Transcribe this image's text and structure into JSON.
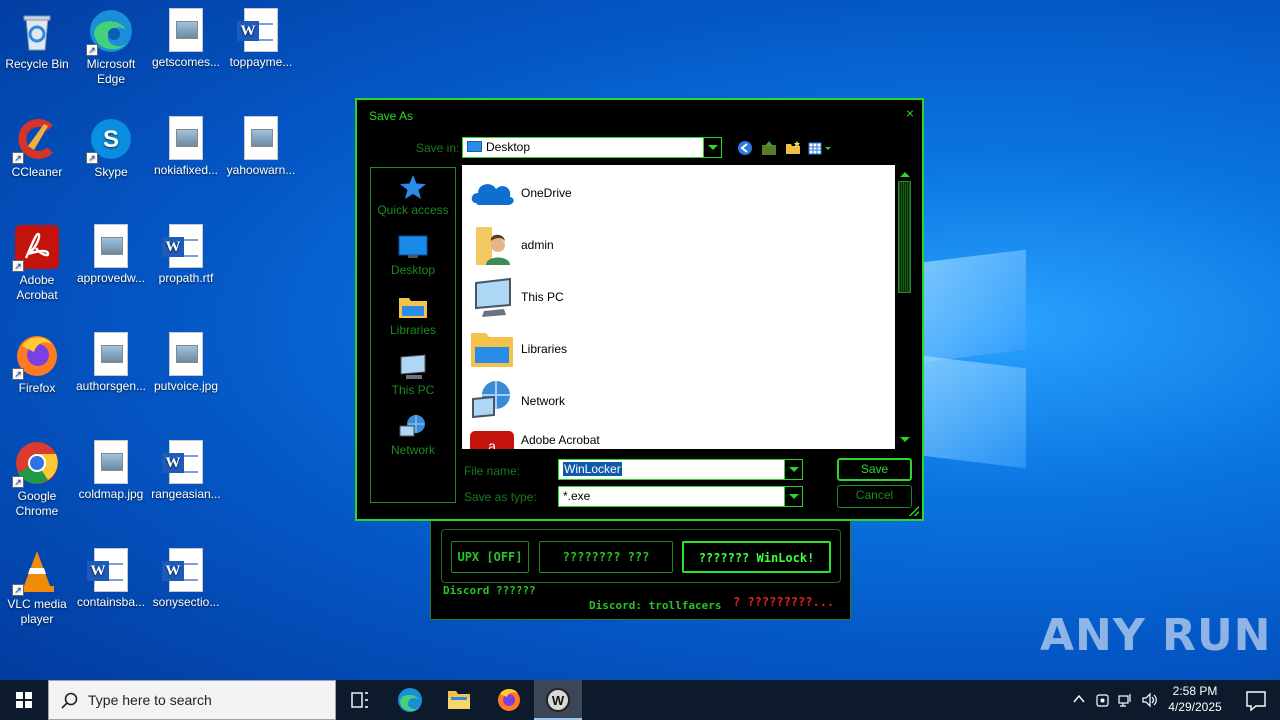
{
  "desktop": {
    "icons": [
      {
        "label": "Recycle Bin",
        "icon": "recycle-bin-icon"
      },
      {
        "label": "Microsoft Edge",
        "icon": "edge-icon"
      },
      {
        "label": "getscomes...",
        "icon": "image-file-icon"
      },
      {
        "label": "toppayme...",
        "icon": "word-doc-icon"
      },
      {
        "label": "CCleaner",
        "icon": "ccleaner-icon"
      },
      {
        "label": "Skype",
        "icon": "skype-icon"
      },
      {
        "label": "nokiafixed...",
        "icon": "image-file-icon"
      },
      {
        "label": "yahoowarn...",
        "icon": "image-file-icon"
      },
      {
        "label": "Adobe Acrobat",
        "icon": "acrobat-icon"
      },
      {
        "label": "approvedw...",
        "icon": "image-file-icon"
      },
      {
        "label": "propath.rtf",
        "icon": "word-doc-icon"
      },
      {
        "label": "Firefox",
        "icon": "firefox-icon"
      },
      {
        "label": "authorsgen...",
        "icon": "image-file-icon"
      },
      {
        "label": "putvoice.jpg",
        "icon": "image-file-icon"
      },
      {
        "label": "Google Chrome",
        "icon": "chrome-icon"
      },
      {
        "label": "coldmap.jpg",
        "icon": "image-file-icon"
      },
      {
        "label": "rangeasian...",
        "icon": "word-doc-icon"
      },
      {
        "label": "VLC media player",
        "icon": "vlc-icon"
      },
      {
        "label": "containsba...",
        "icon": "word-doc-icon"
      },
      {
        "label": "sonysectio...",
        "icon": "word-doc-icon"
      }
    ]
  },
  "dialog": {
    "title": "Save As",
    "close": "×",
    "save_in_label": "Save in:",
    "save_in_value": "Desktop",
    "places": [
      {
        "label": "Quick access"
      },
      {
        "label": "Desktop"
      },
      {
        "label": "Libraries"
      },
      {
        "label": "This PC"
      },
      {
        "label": "Network"
      }
    ],
    "files": [
      {
        "name": "OneDrive"
      },
      {
        "name": "admin"
      },
      {
        "name": "This PC"
      },
      {
        "name": "Libraries"
      },
      {
        "name": "Network"
      },
      {
        "name": "Adobe Acrobat"
      }
    ],
    "file_name_label": "File name:",
    "file_name_value": "WinLocker",
    "save_type_label": "Save as type:",
    "save_type_value": "*.exe",
    "save_button": "Save",
    "cancel_button": "Cancel"
  },
  "winlocker": {
    "btn_upx": "UPX [OFF]",
    "btn_mid": "???????? ???",
    "btn_main": "??????? WinLock!",
    "discord_left": "Discord ??????",
    "discord_right": "Discord: trollfacers",
    "status": "? ?????????...",
    "colors": {
      "accent": "#2ae62a",
      "status": "#e02020"
    }
  },
  "watermark": "ANY RUN",
  "taskbar": {
    "search_placeholder": "Type here to search",
    "time": "2:58 PM",
    "date": "4/29/2025"
  }
}
